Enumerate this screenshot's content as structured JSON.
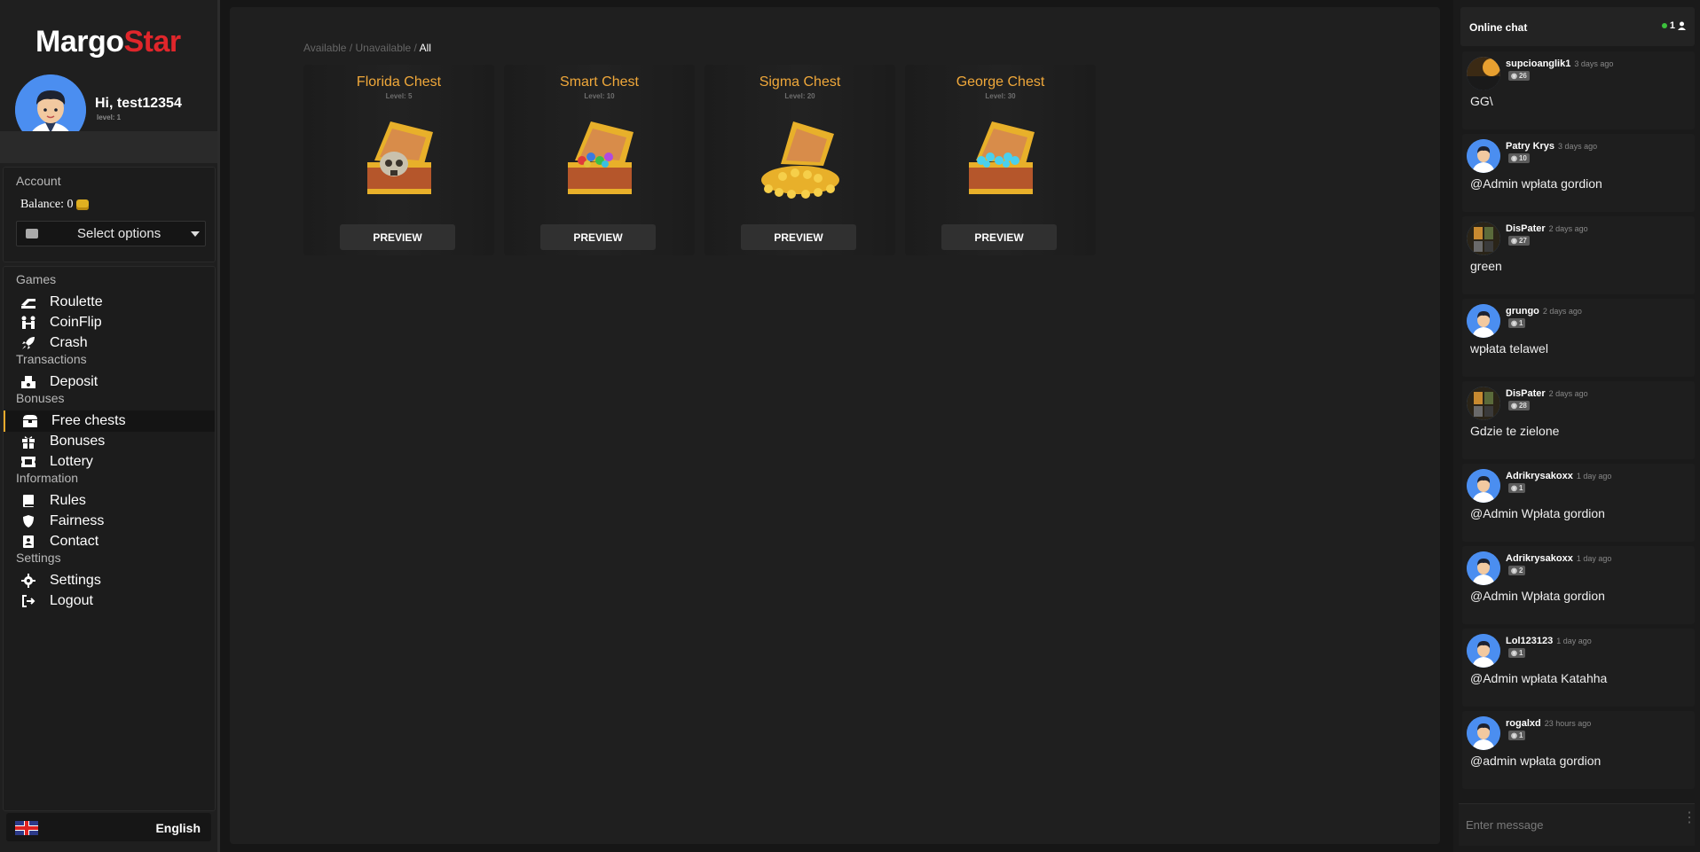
{
  "logo": {
    "part1": "Margo",
    "part2": "Star"
  },
  "profile": {
    "greeting": "Hi, test12354",
    "level": "level: 1"
  },
  "account": {
    "section_label": "Account",
    "balance_label": "Balance: 0",
    "select_placeholder": "Select options"
  },
  "nav": {
    "groups": {
      "games": "Games",
      "transactions": "Transactions",
      "bonuses": "Bonuses",
      "information": "Information",
      "settings": "Settings"
    },
    "items": {
      "roulette": "Roulette",
      "coinflip": "CoinFlip",
      "crash": "Crash",
      "deposit": "Deposit",
      "free_chests": "Free chests",
      "bonuses": "Bonuses",
      "lottery": "Lottery",
      "rules": "Rules",
      "fairness": "Fairness",
      "contact": "Contact",
      "settings": "Settings",
      "logout": "Logout"
    }
  },
  "language": {
    "label": "English"
  },
  "filters": {
    "available": "Available",
    "sep1": " / ",
    "unavailable": "Unavailable",
    "sep2": " / ",
    "all": "All"
  },
  "chests": [
    {
      "title": "Florida Chest",
      "level": "Level: 5",
      "button": "PREVIEW",
      "contents": "skull"
    },
    {
      "title": "Smart Chest",
      "level": "Level: 10",
      "button": "PREVIEW",
      "contents": "gems"
    },
    {
      "title": "Sigma Chest",
      "level": "Level: 20",
      "button": "PREVIEW",
      "contents": "gold"
    },
    {
      "title": "George Chest",
      "level": "Level: 30",
      "button": "PREVIEW",
      "contents": "diamonds"
    }
  ],
  "chat": {
    "title": "Online chat",
    "online_count": "1",
    "input_placeholder": "Enter message",
    "messages": [
      {
        "user": "supcioanglik1",
        "time": "3 days ago",
        "level": "26",
        "text": "GG\\"
      },
      {
        "user": "Patry Krys",
        "time": "3 days ago",
        "level": "10",
        "text": "@Admin wpłata gordion"
      },
      {
        "user": "DisPater",
        "time": "2 days ago",
        "level": "27",
        "text": "green"
      },
      {
        "user": "grungo",
        "time": "2 days ago",
        "level": "1",
        "text": "wpłata telawel"
      },
      {
        "user": "DisPater",
        "time": "2 days ago",
        "level": "28",
        "text": "Gdzie te zielone"
      },
      {
        "user": "Adrikrysakoxx",
        "time": "1 day ago",
        "level": "1",
        "text": "@Admin Wpłata gordion"
      },
      {
        "user": "Adrikrysakoxx",
        "time": "1 day ago",
        "level": "2",
        "text": "@Admin Wpłata gordion"
      },
      {
        "user": "Lol123123",
        "time": "1 day ago",
        "level": "1",
        "text": "@Admin wpłata Katahha"
      },
      {
        "user": "rogalxd",
        "time": "23 hours ago",
        "level": "1",
        "text": "@admin wpłata gordion"
      }
    ]
  },
  "colors": {
    "accent": "#f0a83a",
    "logo_red": "#e0262b",
    "avatar_blue": "#4b8ef0",
    "online_green": "#3cc13c"
  }
}
